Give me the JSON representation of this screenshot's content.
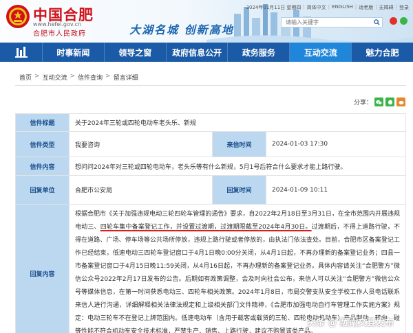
{
  "header": {
    "site_name": "中国合肥",
    "site_url": "www.hefei.gov.cn",
    "site_sub": "合肥市人民政府",
    "slogan": "大湖名城  创新高地",
    "date": "2024年01月11日 星期四",
    "topbar_links": [
      "简体中文",
      "ENGLISH",
      "适老版",
      "无障碍",
      "登录"
    ],
    "search_placeholder": "请输入关键字"
  },
  "nav": {
    "items": [
      {
        "label": "时事新闻",
        "active": false
      },
      {
        "label": "领导之窗",
        "active": false
      },
      {
        "label": "政府信息公开",
        "active": false
      },
      {
        "label": "政务服务",
        "active": false
      },
      {
        "label": "互动交流",
        "active": true
      },
      {
        "label": "魅力合肥",
        "active": false
      }
    ]
  },
  "breadcrumb": [
    "首页",
    "互动交流",
    "信件查询",
    "留言详细"
  ],
  "share_label": "分享：",
  "letter": {
    "title_label": "信件标题",
    "title_value": "关于2024年三轮或四轮电动车老头乐、新规",
    "type_label": "信件类型",
    "type_value": "我要咨询",
    "date_label": "来信时间",
    "date_value": "2024-01-03 17:30",
    "content_label": "信件内容",
    "content_value": "想问问2024年对三轮或四轮电动车，老头乐等有什么新规，5月1号后符合什么要求才能上路行驶。",
    "unit_label": "回复单位",
    "unit_value": "合肥市公安局",
    "reply_date_label": "回复时间",
    "reply_date_value": "2024-01-09 10:11",
    "reply_label": "回复内容",
    "reply_parts": [
      "根据合肥市《关于加强违规电动三轮四轮车管理的通告》要求，自2022年2月18日至3月31日，在全市范围内开展违规电动三、",
      "四轮车集中备案登记工作，并设置过渡期，过渡期限截至2024年4月30日。",
      "过渡期后，不得上道路行驶，不得在道路、广场、停车场等公共场所停放，违规上路行驶或者停放的，由执法门依法查处。目前，合肥市区备案登记工作已经结束，低速电动三四轮车登记窗口于4月1日晚0:00分关闭，从4月1日起，不再办理新的备案登记业务；四县一市备案登记窗口于4月15日晚11:59关闭，从4月16日起，不再办理新的备案登记业务。具体内容请关注“合肥警方”微信公众号2022年2月17日发布的公告。后期如有政策调整，会及时向社会公布，来信人可以关注“合肥警方”微信公众号等媒体信息，在第一时间获悉电动三、四轮车相关政策。2024年1月8日，市局交警支队安全学校工作人员电话联系来信人进行沟通，详细解释相关法律法规定和上级相关部门文件精神，《合肥市加强电动自行车管理工作实施方案》规定：电动三轮车不在登记上牌范围内。低速电动车（含用于载客或载货的三轮、四轮电动机动车）产品制动、转向、碰等性能不符合机动车安全技术标准，严禁生产、销售、上路行驶，建议不购置该类产品。"
    ]
  },
  "watermark": "头条 @ 陇南文县发布",
  "colors": {
    "brand_red": "#d1121b",
    "nav_blue": "#1b5aa6",
    "nav_active": "#1f86d9",
    "label_bg": "#bcd8f0"
  },
  "icons": [
    "emblem-icon",
    "search-icon",
    "weibo-icon",
    "wechat-icon",
    "home-icon",
    "share-wechat-icon",
    "share-qq-icon",
    "share-weibo-icon"
  ]
}
